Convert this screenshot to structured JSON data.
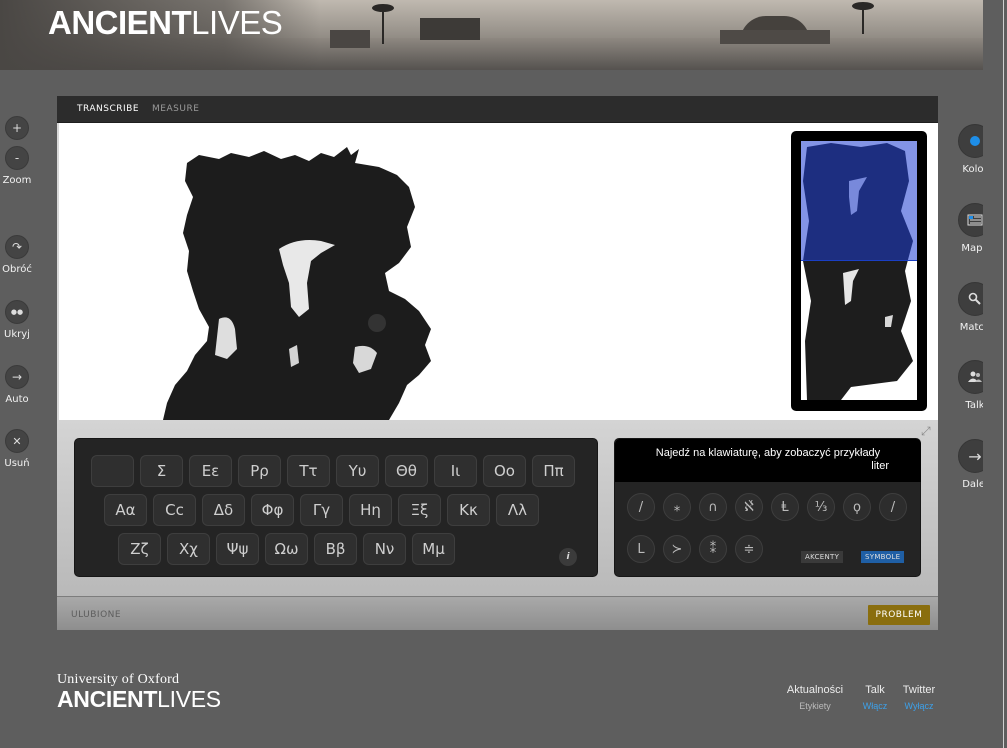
{
  "header": {
    "logo_bold": "ANCIENT",
    "logo_light": "LIVES"
  },
  "left_tools": [
    {
      "name": "zoom-in-button",
      "glyph": "+",
      "label": ""
    },
    {
      "name": "zoom-out-button",
      "glyph": "-",
      "label": "Zoom"
    },
    {
      "name": "rotate-button",
      "glyph": "↷",
      "label": "Obróć"
    },
    {
      "name": "hide-button",
      "glyph": "●●",
      "label": "Ukryj"
    },
    {
      "name": "auto-button",
      "glyph": "→",
      "label": "Auto"
    },
    {
      "name": "delete-button",
      "glyph": "✕",
      "label": "Usuń"
    }
  ],
  "right_tools": [
    {
      "name": "color-button",
      "label": "Kolor"
    },
    {
      "name": "map-button",
      "label": "Mapa"
    },
    {
      "name": "match-button",
      "label": "Match"
    },
    {
      "name": "talk-button",
      "label": "Talk"
    },
    {
      "name": "next-button",
      "label": "Dalej"
    }
  ],
  "tabs": [
    {
      "label": "TRANSCRIBE",
      "active": true
    },
    {
      "label": "MEASURE",
      "active": false
    }
  ],
  "keyboard": {
    "rows": [
      [
        "",
        "Σ",
        "Εε",
        "Ρρ",
        "Ττ",
        "Υυ",
        "Θθ",
        "Ιι",
        "Οο",
        "Ππ"
      ],
      [
        "Αα",
        "Cc",
        "Δδ",
        "Φφ",
        "Γγ",
        "Ηη",
        "Ξξ",
        "Κκ",
        "Λλ"
      ],
      [
        "Ζζ",
        "Χχ",
        "Ψψ",
        "Ωω",
        "Ββ",
        "Νν",
        "Μμ"
      ]
    ],
    "info_label": "i"
  },
  "symbols": {
    "tooltip_line1": "Najedź na klawiaturę, aby zobaczyć przykłady",
    "tooltip_line2": "liter",
    "row1": [
      "/",
      "⁎",
      "∩",
      "ℵ̌",
      "Ⱡ",
      "⅓",
      "ϙ",
      "/"
    ],
    "row2": [
      "L",
      "≻",
      "⁑",
      "≑"
    ],
    "accents_label": "AKCENTY",
    "symbols_label": "SYMBOLE"
  },
  "bottom_bar": {
    "favorites_label": "ULUBIONE",
    "problem_label": "PROBLEM"
  },
  "footer": {
    "university": "University of Oxford",
    "logo_bold": "ANCIENT",
    "logo_light": "LIVES",
    "news": "Aktualności",
    "talk": "Talk",
    "twitter": "Twitter",
    "labels": "Etykiety",
    "enable": "Włącz",
    "disable": "Wyłącz"
  },
  "colors": {
    "accent_blue": "#1e8ee8",
    "problem_gold": "#8a6e0e",
    "symbols_active": "#1f5fa5",
    "link_blue": "#3da1ea"
  }
}
